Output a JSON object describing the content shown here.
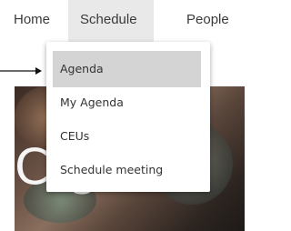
{
  "nav": {
    "home": "Home",
    "schedule": "Schedule",
    "people": "People"
  },
  "hero": {
    "partial_text": "C         g  T"
  },
  "dropdown": {
    "items": [
      {
        "label": "Agenda"
      },
      {
        "label": "My Agenda"
      },
      {
        "label": "CEUs"
      },
      {
        "label": "Schedule meeting"
      }
    ]
  },
  "colors": {
    "highlight": "#d4d4d4",
    "nav_active_bg": "#e9e9e9"
  }
}
